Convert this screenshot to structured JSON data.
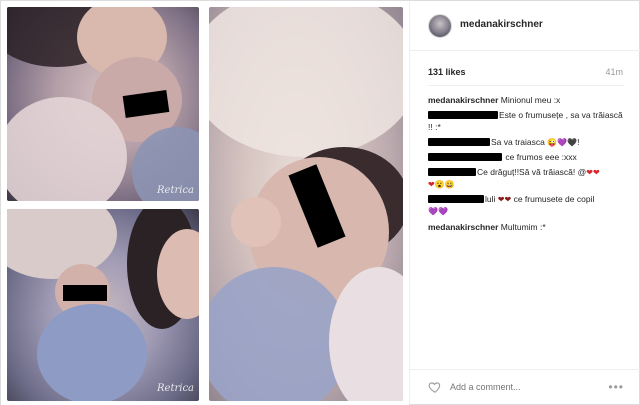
{
  "post": {
    "username": "medanakirschner",
    "likes": "131 likes",
    "time": "41m",
    "watermark": "Retrica"
  },
  "comments": [
    {
      "user": "medanakirschner",
      "text": "Minionul meu :x",
      "redacted": false
    },
    {
      "user": "",
      "text": "Este o frumusețe , sa va trăiască !! :*",
      "redacted": true
    },
    {
      "user": "",
      "text": "Sa va traiasca",
      "redacted": true,
      "emojis": [
        "😜",
        "💜",
        "🖤",
        "!"
      ]
    },
    {
      "user": "",
      "text": "ce frumos eee :xxx",
      "redacted": true
    },
    {
      "user": "",
      "text": "Ce drăguț!!Să vă trăiască! @",
      "redacted": true,
      "emojis": [
        "❤",
        "❤",
        "❤",
        "😮",
        "😀"
      ]
    },
    {
      "user": "",
      "text": "luli",
      "redacted": true,
      "emojis": [
        "❤",
        "❤"
      ],
      "text2": "ce frumusete de copil",
      "emojis2": [
        "💜",
        "💜"
      ]
    },
    {
      "user": "medanakirschner",
      "text": "Multumim :*",
      "redacted": false
    }
  ],
  "footer": {
    "add_placeholder": "Add a comment...",
    "more_glyph": "•••"
  },
  "icons": {
    "heart": "heart-icon",
    "more": "more-options-icon",
    "avatar": "avatar"
  },
  "colors": {
    "redaction": "#000000",
    "muted": "#999999",
    "text": "#262626"
  }
}
